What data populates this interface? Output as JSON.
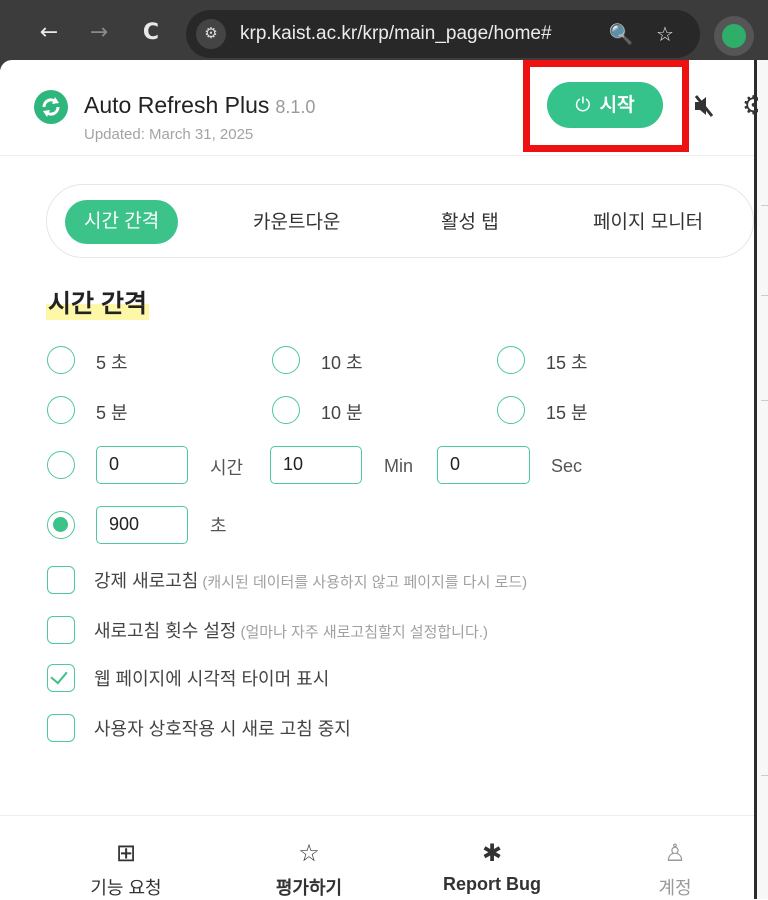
{
  "browser": {
    "url": "krp.kaist.ac.kr/krp/main_page/home#",
    "back_icon": "←",
    "forward_icon": "→",
    "reload_icon": "C",
    "site_info_icon": "⚙",
    "zoom_icon": "🔍",
    "bookmark_icon": "☆"
  },
  "header": {
    "title": "Auto Refresh Plus",
    "version": "8.1.0",
    "updated": "Updated: March 31, 2025",
    "start_label": "시작",
    "start_icon": "⏻",
    "gear_icon": "⚙"
  },
  "tabs": [
    {
      "label": "시간 간격",
      "active": true
    },
    {
      "label": "카운트다운",
      "active": false
    },
    {
      "label": "활성 탭",
      "active": false
    },
    {
      "label": "페이지 모니터",
      "active": false
    }
  ],
  "section_title": "시간 간격",
  "intervals": [
    {
      "label": "5 초"
    },
    {
      "label": "10 초"
    },
    {
      "label": "15 초"
    },
    {
      "label": "5 분"
    },
    {
      "label": "10 분"
    },
    {
      "label": "15 분"
    }
  ],
  "custom_time": {
    "hours_value": "0",
    "hours_unit": "시간",
    "minutes_value": "10",
    "minutes_unit": "Min",
    "seconds_value": "0",
    "seconds_unit": "Sec"
  },
  "seconds_option": {
    "value": "900",
    "unit": "초",
    "selected": true
  },
  "options": [
    {
      "label": "강제 새로고침",
      "note": "(캐시된 데이터를 사용하지 않고 페이지를 다시 로드)",
      "checked": false
    },
    {
      "label": "새로고침 횟수 설정",
      "note": "(얼마나 자주 새로고침할지 설정합니다.)",
      "checked": false
    },
    {
      "label": "웹 페이지에 시각적 타이머 표시",
      "note": "",
      "checked": true
    },
    {
      "label": "사용자 상호작용 시 새로 고침 중지",
      "note": "",
      "checked": false
    }
  ],
  "footer": [
    {
      "label": "기능 요청",
      "icon": "⊞"
    },
    {
      "label": "평가하기",
      "icon": "☆"
    },
    {
      "label": "Report Bug",
      "icon": "✱"
    },
    {
      "label": "계정",
      "icon": "♙"
    }
  ],
  "colors": {
    "accent": "#3cc38a",
    "highlight_box": "#ee1111",
    "title_highlight": "#fdf7a8"
  }
}
